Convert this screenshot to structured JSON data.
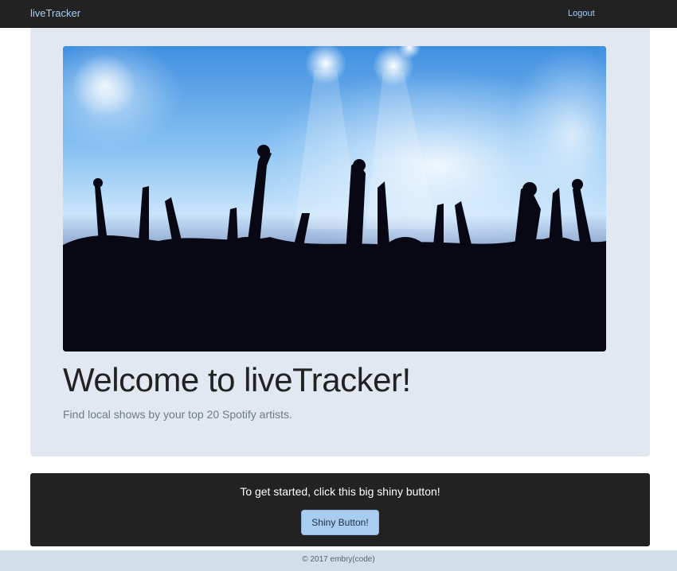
{
  "navbar": {
    "brand": "liveTracker",
    "logout_label": "Logout"
  },
  "jumbotron": {
    "heading": "Welcome to liveTracker!",
    "tagline": "Find local shows by your top 20 Spotify artists."
  },
  "cta": {
    "prompt": "To get started, click this big shiny button!",
    "button_label": "Shiny Button!"
  },
  "footer": {
    "text": "© 2017 embry(code)"
  },
  "colors": {
    "navbar_bg": "#222222",
    "link": "#a9cdf0",
    "jumbotron_bg": "#e1e8f1",
    "cta_bg": "#222222",
    "button_bg": "#a9cdf0",
    "footer_bg": "#d2dee9"
  }
}
